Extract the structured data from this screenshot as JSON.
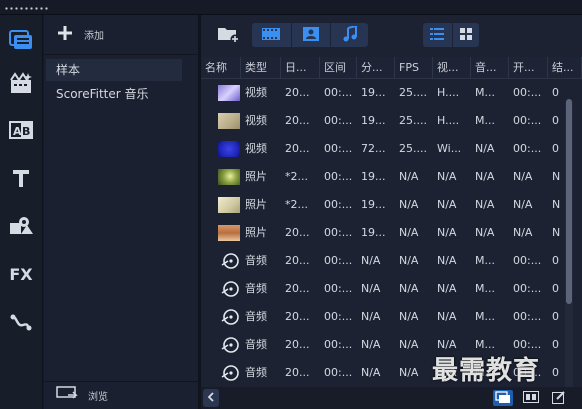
{
  "rail": {
    "items": [
      {
        "name": "media",
        "icon": "media-library-icon",
        "active": true
      },
      {
        "name": "instant-project",
        "icon": "instant-project-icon"
      },
      {
        "name": "transitions",
        "icon": "transition-icon"
      },
      {
        "name": "title",
        "icon": "title-icon"
      },
      {
        "name": "graphics",
        "icon": "graphics-icon"
      },
      {
        "name": "filters",
        "icon": "fx-icon",
        "label": "FX"
      },
      {
        "name": "path",
        "icon": "motion-path-icon"
      }
    ]
  },
  "library": {
    "add_label": "添加",
    "items": [
      {
        "label": "样本",
        "selected": true
      },
      {
        "label": "ScoreFitter 音乐",
        "selected": false
      }
    ],
    "browse_label": "浏览"
  },
  "table": {
    "headers": [
      "名称",
      "类型",
      "日...",
      "区间",
      "分...",
      "FPS",
      "视...",
      "音...",
      "开...",
      "结..."
    ],
    "rows": [
      {
        "thumb": "video-purple",
        "cells": [
          "视频",
          "20...",
          "00:...",
          "19...",
          "25....",
          "H....",
          "M...",
          "00:...",
          "0"
        ]
      },
      {
        "thumb": "video-beige",
        "cells": [
          "视频",
          "20...",
          "00:...",
          "19...",
          "25....",
          "H....",
          "M...",
          "00:...",
          "0"
        ]
      },
      {
        "thumb": "video-blue",
        "cells": [
          "视频",
          "20...",
          "00:...",
          "72...",
          "25....",
          "Wi...",
          "N/A",
          "00:...",
          "0"
        ]
      },
      {
        "thumb": "photo-green",
        "cells": [
          "照片",
          "*2...",
          "00:...",
          "19...",
          "N/A",
          "N/A",
          "N/A",
          "N/A",
          "N"
        ]
      },
      {
        "thumb": "photo-cream",
        "cells": [
          "照片",
          "*2...",
          "00:...",
          "19...",
          "N/A",
          "N/A",
          "N/A",
          "N/A",
          "N"
        ]
      },
      {
        "thumb": "photo-tan",
        "cells": [
          "照片",
          "20...",
          "00:...",
          "19...",
          "N/A",
          "N/A",
          "N/A",
          "N/A",
          "N"
        ]
      },
      {
        "thumb": "audio",
        "cells": [
          "音频",
          "20...",
          "00:...",
          "N/A",
          "N/A",
          "N/A",
          "M...",
          "00:...",
          "0"
        ]
      },
      {
        "thumb": "audio",
        "cells": [
          "音频",
          "20...",
          "00:...",
          "N/A",
          "N/A",
          "N/A",
          "M...",
          "00:...",
          "0"
        ]
      },
      {
        "thumb": "audio",
        "cells": [
          "音频",
          "20...",
          "00:...",
          "N/A",
          "N/A",
          "N/A",
          "M...",
          "00:...",
          "0"
        ]
      },
      {
        "thumb": "audio",
        "cells": [
          "音频",
          "20...",
          "00:...",
          "N/A",
          "N/A",
          "N/A",
          "M...",
          "00:...",
          "0"
        ]
      },
      {
        "thumb": "audio",
        "cells": [
          "音频",
          "20...",
          "00:...",
          "N/A",
          "N/A",
          "N/A",
          "M...",
          "00:...",
          "0"
        ]
      }
    ]
  },
  "toolbar": {
    "import_icon": "folder-add-icon",
    "filters": [
      "video-filter-icon",
      "photo-filter-icon",
      "audio-filter-icon"
    ],
    "views": [
      "list-view-icon",
      "thumbnail-view-icon"
    ]
  },
  "watermark": "最需教育",
  "colors": {
    "accent": "#3a8ff0",
    "panel": "#1c2232",
    "rail": "#181d2a",
    "selected": "#232c3f"
  }
}
